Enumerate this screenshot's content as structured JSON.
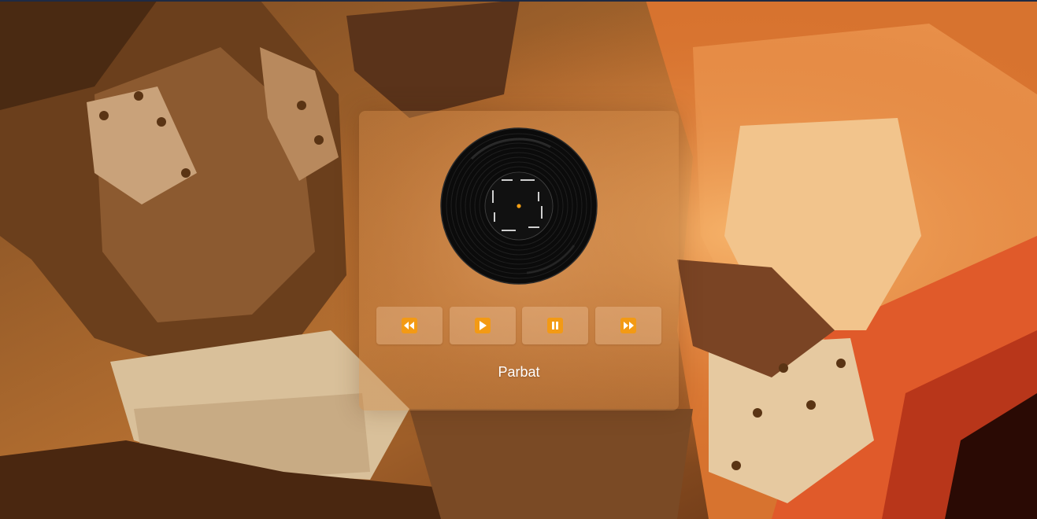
{
  "player": {
    "song_title": "Parbat",
    "controls": [
      {
        "name": "previous",
        "icon": "rewind-icon"
      },
      {
        "name": "play",
        "icon": "play-icon"
      },
      {
        "name": "pause",
        "icon": "pause-icon"
      },
      {
        "name": "next",
        "icon": "fast-forward-icon"
      }
    ],
    "disc_icon": "vinyl-record-icon"
  },
  "colors": {
    "accent_orange": "#f5a015",
    "button_icon_bg": "#f39a14",
    "title_text": "#ffffff"
  }
}
